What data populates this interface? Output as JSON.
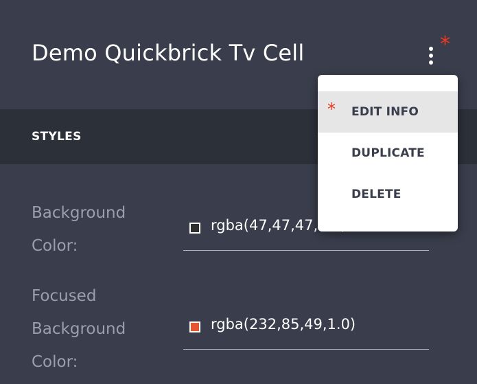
{
  "header": {
    "title": "Demo Quickbrick Tv Cell",
    "required_marker": "*"
  },
  "section": {
    "heading": "STYLES"
  },
  "fields": [
    {
      "label_lines": [
        "Background",
        "Color:"
      ],
      "value": "rgba(47,47,47,1.0)",
      "swatch_color": "#2f2f2f"
    },
    {
      "label_lines": [
        "Focused",
        "Background",
        "Color:"
      ],
      "value": "rgba(232,85,49,1.0)",
      "swatch_color": "#e85531"
    }
  ],
  "menu": {
    "items": [
      {
        "label": "EDIT INFO",
        "active": true,
        "marker": "*"
      },
      {
        "label": "DUPLICATE",
        "active": false
      },
      {
        "label": "DELETE",
        "active": false
      }
    ]
  },
  "icons": {
    "menu": "more-vertical-icon"
  },
  "colors": {
    "background": "#3a3e4c",
    "band": "#2c3039",
    "accent_required": "#f0381e",
    "label": "#9b9faa"
  }
}
